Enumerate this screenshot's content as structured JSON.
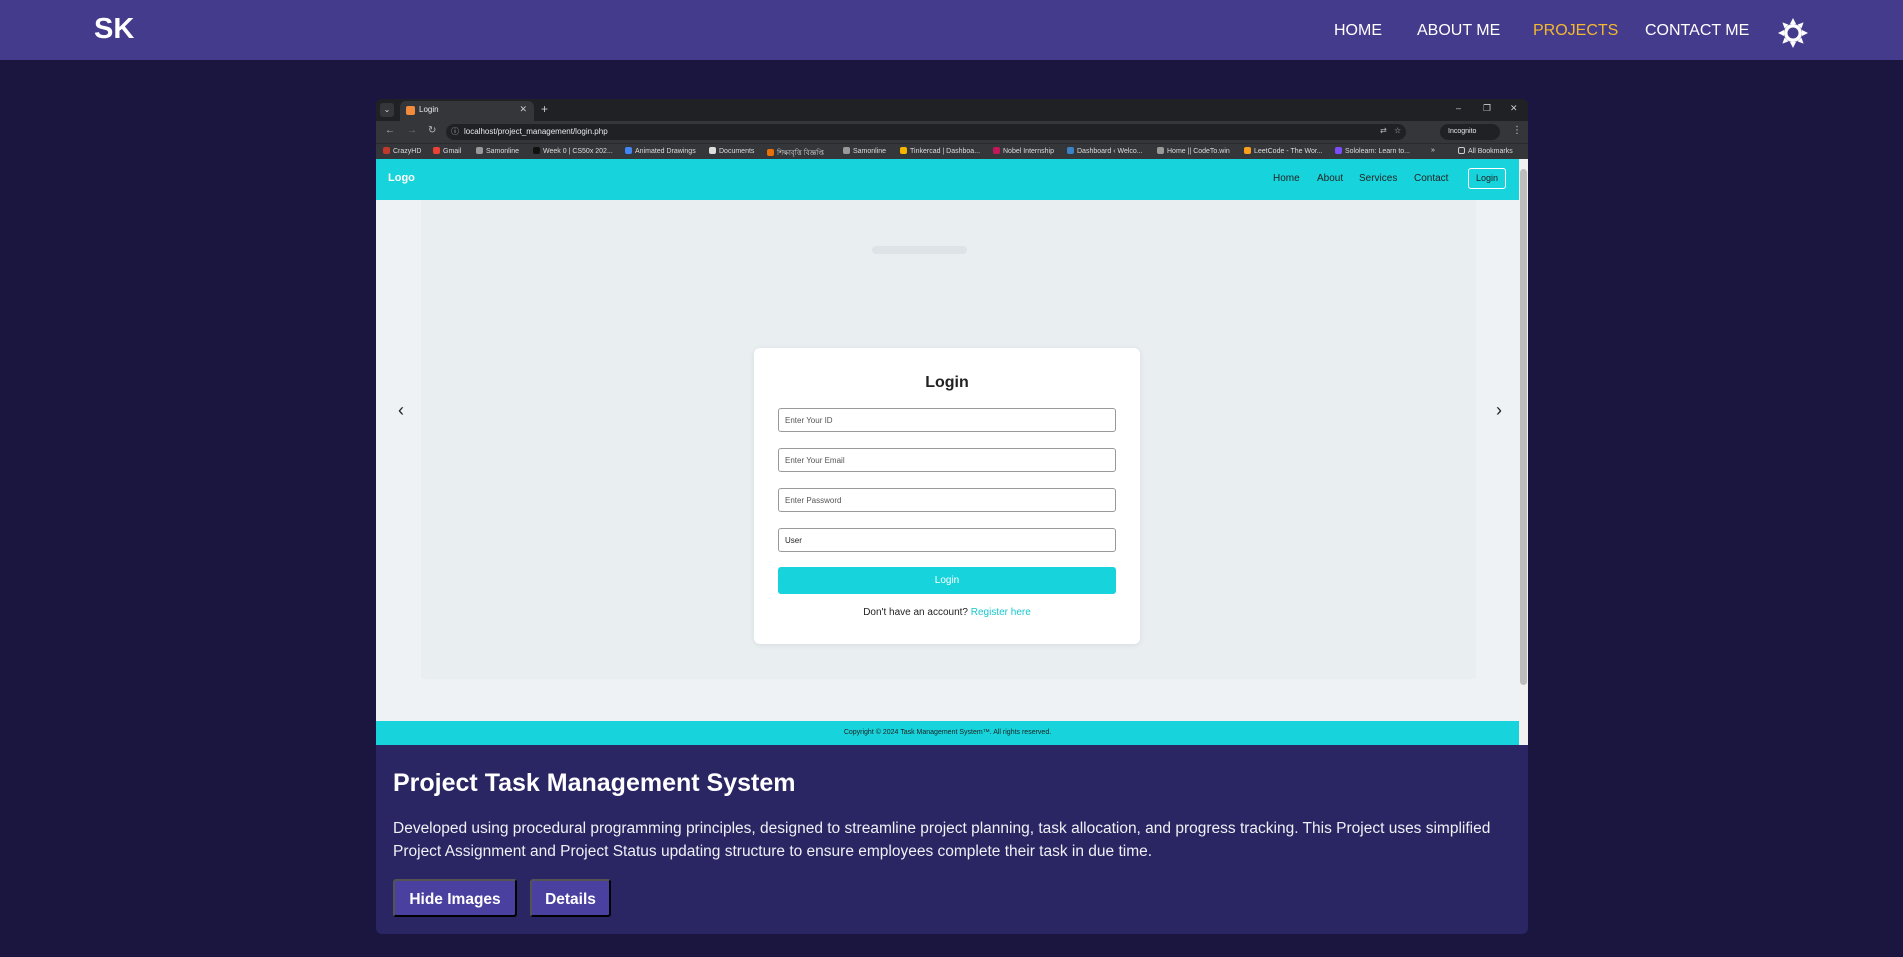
{
  "nav": {
    "logo": "SK",
    "links": [
      {
        "label": "HOME",
        "active": false
      },
      {
        "label": "ABOUT ME",
        "active": false
      },
      {
        "label": "PROJECTS",
        "active": true
      },
      {
        "label": "CONTACT ME",
        "active": false
      }
    ],
    "theme_icon": "sun-icon",
    "active_color": "#f5b82e",
    "background": "#443b8c"
  },
  "project": {
    "title": "Project Task Management System",
    "description": "Developed using procedural programming principles, designed to streamline project planning, task allocation, and progress tracking. This Project uses simplified Project Assignment and Project Status updating structure to ensure employees complete their task in due time.",
    "buttons": {
      "hide_images": "Hide Images",
      "details": "Details"
    }
  },
  "screenshot": {
    "browser": {
      "tab_title": "Login",
      "url": "localhost/project_management/login.php",
      "incognito_label": "Incognito",
      "bookmarks": [
        "CrazyHD",
        "Gmail",
        "Samonline",
        "Week 0 | CS50x 202...",
        "Animated Drawings",
        "Documents",
        "শিক্ষাবৃত্তি বিজ্ঞপ্তি",
        "Samonline",
        "Tinkercad | Dashboa...",
        "Nobel Internship",
        "Dashboard ‹ Welco...",
        "Home || CodeTo.win",
        "LeetCode - The Wor...",
        "Sololearn: Learn to..."
      ],
      "all_bookmarks": "All Bookmarks"
    },
    "site": {
      "logo": "Logo",
      "links": [
        "Home",
        "About",
        "Services",
        "Contact"
      ],
      "login_link": "Login",
      "prev_arrow": "‹",
      "next_arrow": "›",
      "form": {
        "title": "Login",
        "id_placeholder": "Enter Your ID",
        "email_placeholder": "Enter Your Email",
        "password_placeholder": "Enter Password",
        "role_value": "User",
        "submit": "Login",
        "register_prompt": "Don't have an account?",
        "register_link": "Register here"
      },
      "footer": "Copyright © 2024 Task Management System™. All rights reserved.",
      "accent": "#17d4dc"
    }
  }
}
